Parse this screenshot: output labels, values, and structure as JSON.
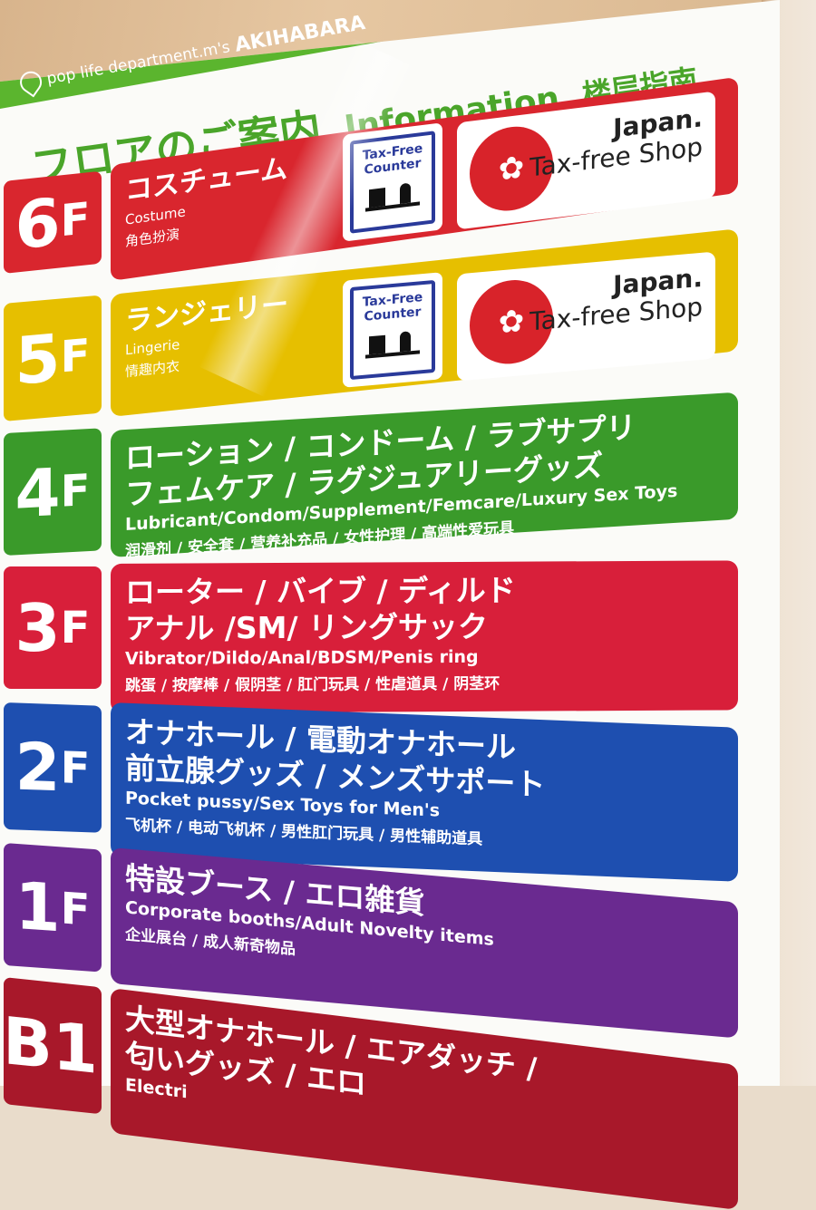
{
  "header": {
    "brand": "pop life department.m's",
    "location": "AKIHABARA",
    "title_jp": "フロアのご案内",
    "title_en": "Information",
    "title_cn": "楼层指南",
    "brand_color": "#5bb52e"
  },
  "tax_free": {
    "counter": "Tax-Free Counter",
    "shop_title": "Japan.",
    "shop_sub": "Tax-free Shop"
  },
  "floors": [
    {
      "label": "6",
      "suffix": "F",
      "jp": [
        "コスチューム"
      ],
      "en": "Costume",
      "cn": "角色扮演",
      "color": "#d9262e"
    },
    {
      "label": "5",
      "suffix": "F",
      "jp": [
        "ランジェリー"
      ],
      "en": "Lingerie",
      "cn": "情趣内衣",
      "color": "#e6bf00"
    },
    {
      "label": "4",
      "suffix": "F",
      "jp": [
        "ローション / コンドーム / ラブサプリ",
        "フェムケア / ラグジュアリーグッズ"
      ],
      "en": "Lubricant/Condom/Supplement/Femcare/Luxury Sex Toys",
      "cn": "润滑剂 / 安全套 / 营养补充品 / 女性护理 / 高端性爱玩具",
      "color": "#3a9a2a"
    },
    {
      "label": "3",
      "suffix": "F",
      "jp": [
        "ローター / バイブ / ディルド",
        "アナル /SM/ リングサック"
      ],
      "en": "Vibrator/Dildo/Anal/BDSM/Penis ring",
      "cn": "跳蛋 / 按摩棒 / 假阴茎 / 肛门玩具 / 性虐道具 / 阴茎环",
      "color": "#d81f3a"
    },
    {
      "label": "2",
      "suffix": "F",
      "jp": [
        "オナホール / 電動オナホール",
        "前立腺グッズ / メンズサポート"
      ],
      "en": "Pocket pussy/Sex Toys for Men's",
      "cn": "飞机杯 / 电动飞机杯 / 男性肛门玩具 / 男性辅助道具",
      "color": "#1e4fb0"
    },
    {
      "label": "1",
      "suffix": "F",
      "jp": [
        "特設ブース / エロ雑貨"
      ],
      "en": "Corporate booths/Adult Novelty items",
      "cn": "企业展台 / 成人新奇物品",
      "color": "#6a2a90"
    },
    {
      "label": "B1",
      "suffix": "",
      "jp": [
        "大型オナホール / エアダッチ /",
        "匂いグッズ / エロ"
      ],
      "en": "Electri",
      "cn": "",
      "color": "#a8182a"
    }
  ]
}
